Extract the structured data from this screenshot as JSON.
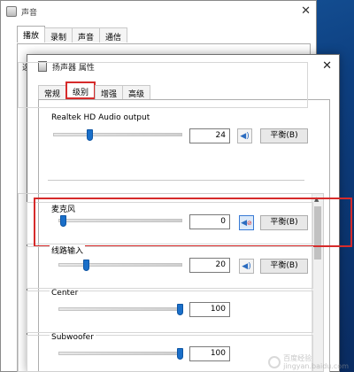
{
  "back_window": {
    "title": "声音",
    "tabs": [
      "播放",
      "录制",
      "声音",
      "通信"
    ],
    "active_tab": 0,
    "stub_line1": "选",
    "stub_line2": ""
  },
  "front_window": {
    "title": "扬声器 属性",
    "tabs": [
      "常规",
      "级别",
      "增强",
      "高级"
    ],
    "active_tab": 1,
    "top_group": {
      "label": "Realtek HD Audio output",
      "volume": "24",
      "balance_label": "平衡(B)"
    },
    "items": [
      {
        "label": "麦克风",
        "volume": "0",
        "balance_label": "平衡(B)",
        "muted": true
      },
      {
        "label": "线路输入",
        "volume": "20",
        "balance_label": "平衡(B)",
        "muted": false
      },
      {
        "label": "Center",
        "volume": "100"
      },
      {
        "label": "Subwoofer",
        "volume": "100"
      }
    ]
  },
  "watermark": {
    "line1": "百度经验",
    "line2": "jingyan.baidu.com"
  },
  "colors": {
    "accent": "#1a6fc9",
    "highlight": "#d62b2b"
  }
}
